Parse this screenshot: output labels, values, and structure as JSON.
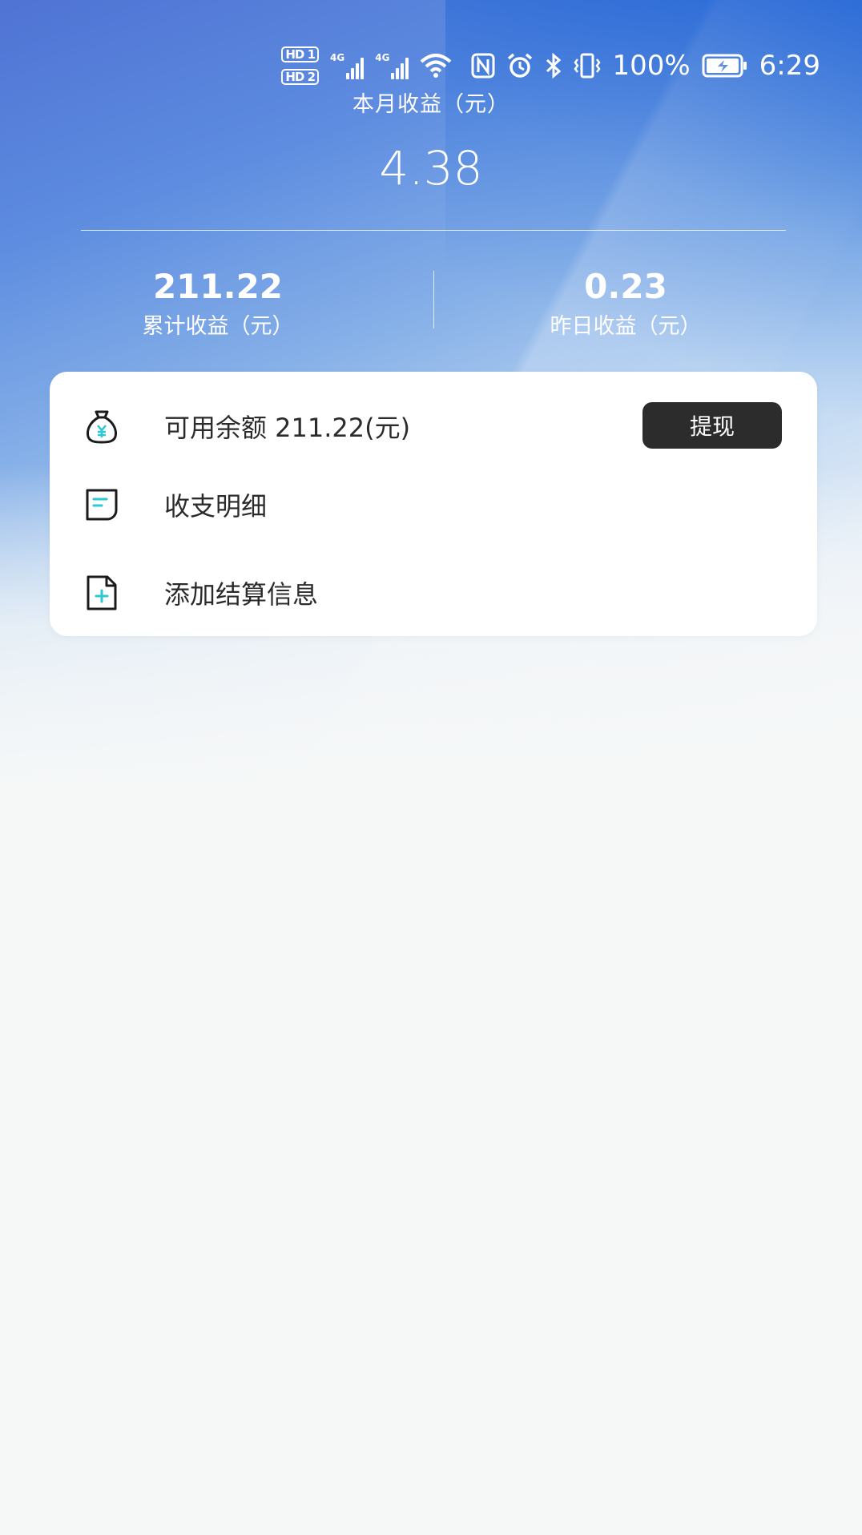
{
  "status_bar": {
    "sim1": "HD 1",
    "sim2": "HD 2",
    "net1": "4G",
    "net2": "4G",
    "battery_percent": "100%",
    "time": "6:29",
    "icons": [
      "signal-icon",
      "wifi-icon",
      "nfc-icon",
      "alarm-icon",
      "bluetooth-icon",
      "vibrate-icon",
      "battery-charging-icon"
    ]
  },
  "header": {
    "title": "本月收益（元）",
    "month_value": "4.38"
  },
  "stats": {
    "total": {
      "value": "211.22",
      "label": "累计收益（元）"
    },
    "yesterday": {
      "value": "0.23",
      "label": "昨日收益（元）"
    }
  },
  "card": {
    "balance_text": "可用余额 211.22(元)",
    "withdraw_label": "提现",
    "details_label": "收支明细",
    "add_settlement_label": "添加结算信息"
  },
  "colors": {
    "accent": "#2ec7d6",
    "button_bg": "#2c2c2c",
    "page_bg": "#f6f8f8"
  }
}
